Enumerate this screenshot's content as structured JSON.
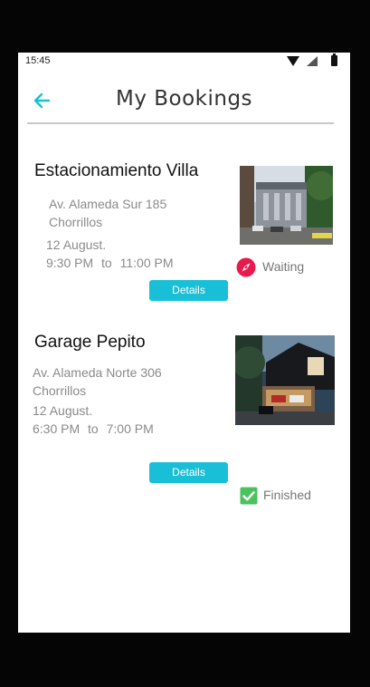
{
  "status_bar": {
    "time": "15:45"
  },
  "header": {
    "title": "My Bookings"
  },
  "bookings": [
    {
      "name": "Estacionamiento Villa",
      "address": "Av. Alameda Sur 185",
      "district": "Chorrillos",
      "date": "12 August.",
      "start": "9:30 PM",
      "to": "to",
      "end": "11:00 PM",
      "status": "Waiting",
      "status_color": "#e8194d",
      "details_label": "Details"
    },
    {
      "name": "Garage Pepito",
      "address": "Av. Alameda Norte 306",
      "district": "Chorrillos",
      "date": "12 August.",
      "start": "6:30 PM",
      "to": "to",
      "end": "7:00 PM",
      "status": "Finished",
      "status_color": "#4cc25f",
      "details_label": "Details"
    }
  ],
  "colors": {
    "accent": "#18bfd6",
    "background": "#050505"
  },
  "icons": {
    "back": "back-arrow-icon",
    "waiting": "compass-icon",
    "finished": "check-box-icon"
  }
}
